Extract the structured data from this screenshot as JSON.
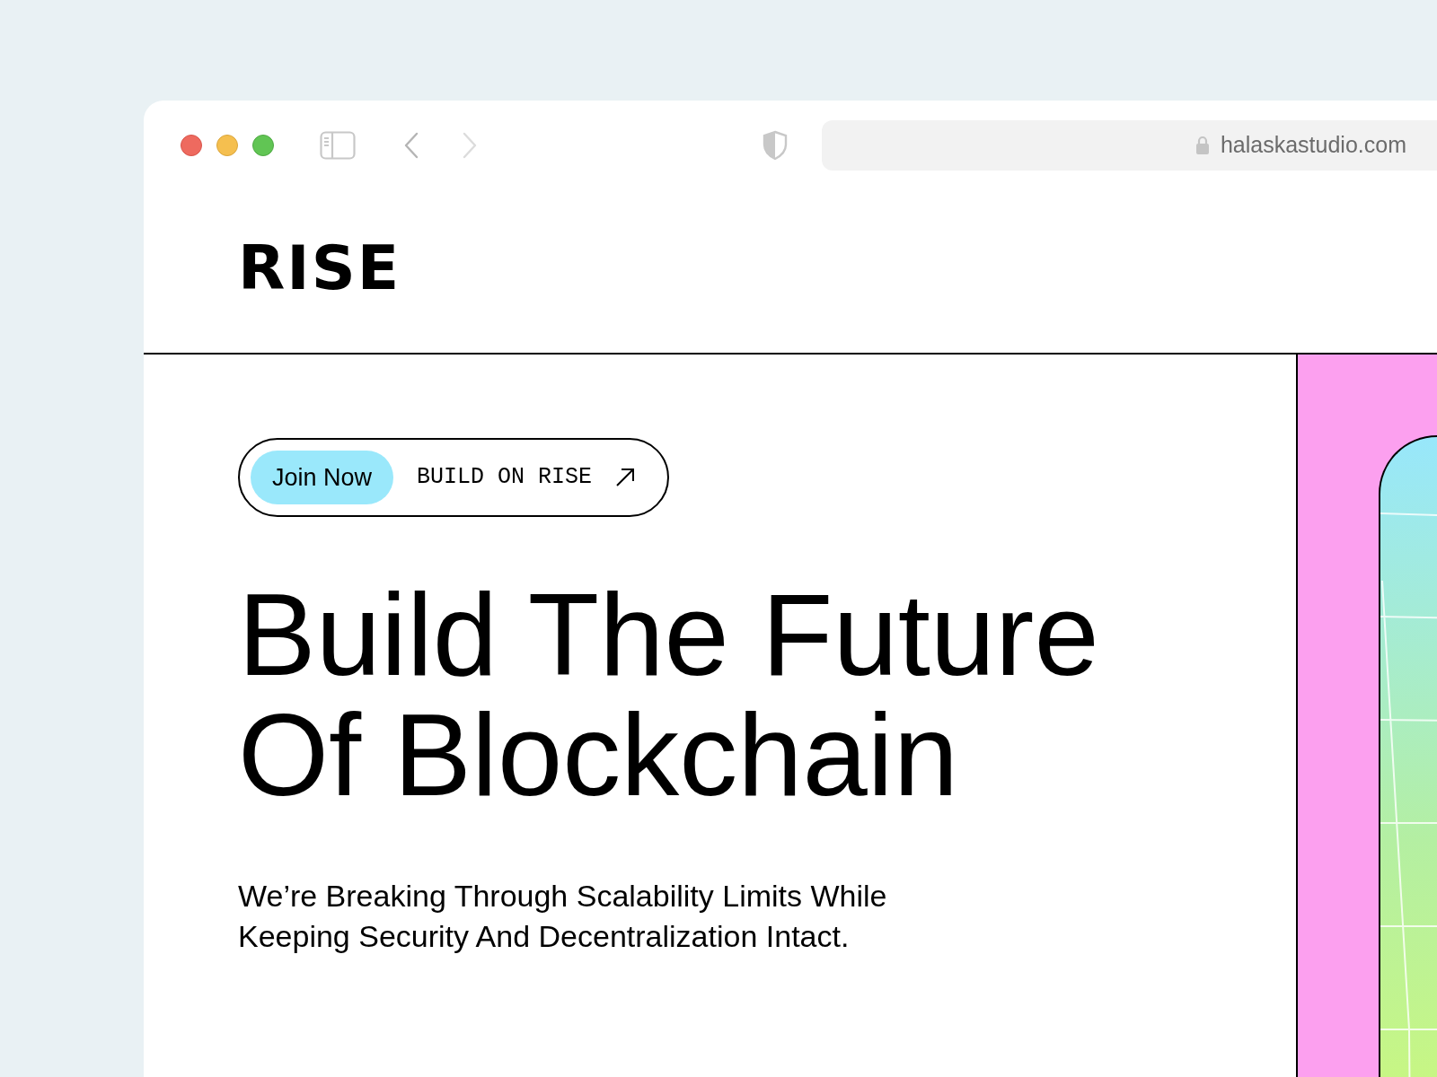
{
  "browser": {
    "url": "halaskastudio.com"
  },
  "header": {
    "logo": "RISE"
  },
  "hero": {
    "badge": {
      "button": "Join Now",
      "link": "BUILD ON RISE"
    },
    "heading_lines": [
      "Build The Future",
      "Of Blockchain"
    ],
    "subtitle": "We’re Breaking Through Scalability Limits While Keeping Security And Decentralization Intact."
  }
}
